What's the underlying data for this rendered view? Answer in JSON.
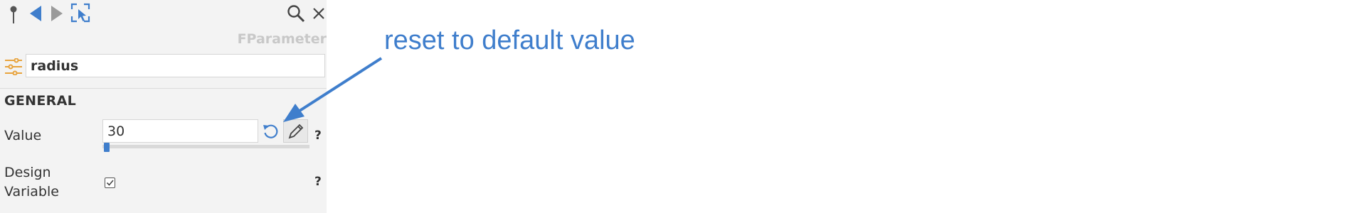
{
  "toolbar": {
    "icons": [
      "pin-icon",
      "back-icon",
      "forward-icon",
      "select-icon",
      "search-icon",
      "close-icon"
    ]
  },
  "panel": {
    "type_label": "FParameter",
    "name_value": "radius",
    "section_title": "GENERAL",
    "rows": {
      "value_label": "Value",
      "value": "30",
      "help": "?",
      "design_variable_label_line1": "Design",
      "design_variable_label_line2": "Variable",
      "design_variable_checked": true
    },
    "slider_fraction": 0.0
  },
  "annotation": {
    "text": "reset to default value"
  },
  "colors": {
    "panel_bg": "#f3f3f3",
    "accent_blue": "#3f7ecc",
    "tune_orange": "#e8a33d",
    "muted_gray": "#c8c8c8"
  }
}
